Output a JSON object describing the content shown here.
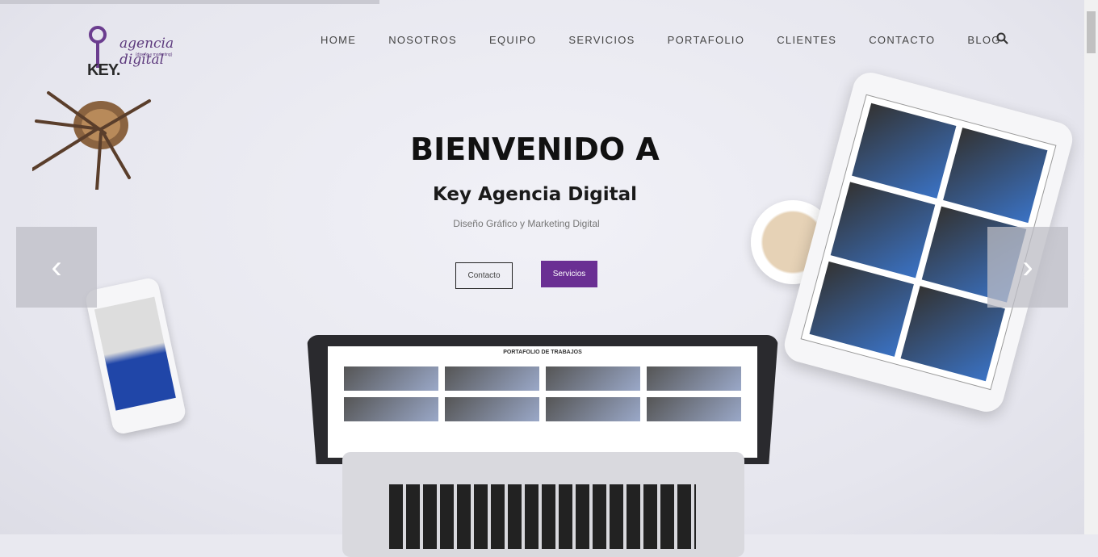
{
  "loading_progress": 0.35,
  "logo": {
    "brand": "KEY.",
    "name": "agencia digital",
    "tagline": "{diseño y marketing}"
  },
  "nav": {
    "items": [
      "HOME",
      "NOSOTROS",
      "EQUIPO",
      "SERVICIOS",
      "PORTAFOLIO",
      "CLIENTES",
      "CONTACTO",
      "BLOG"
    ],
    "search_icon": "search-icon"
  },
  "hero": {
    "title": "BIENVENIDO A",
    "subtitle": "Key Agencia Digital",
    "tagline": "Diseño Gráfico y Marketing Digital",
    "button_contact": "Contacto",
    "button_services": "Servicios",
    "laptop_screen_title": "PORTAFOLIO DE TRABAJOS"
  },
  "carousel": {
    "prev": "‹",
    "next": "›"
  },
  "colors": {
    "accent": "#6a2f93",
    "text": "#111111"
  }
}
